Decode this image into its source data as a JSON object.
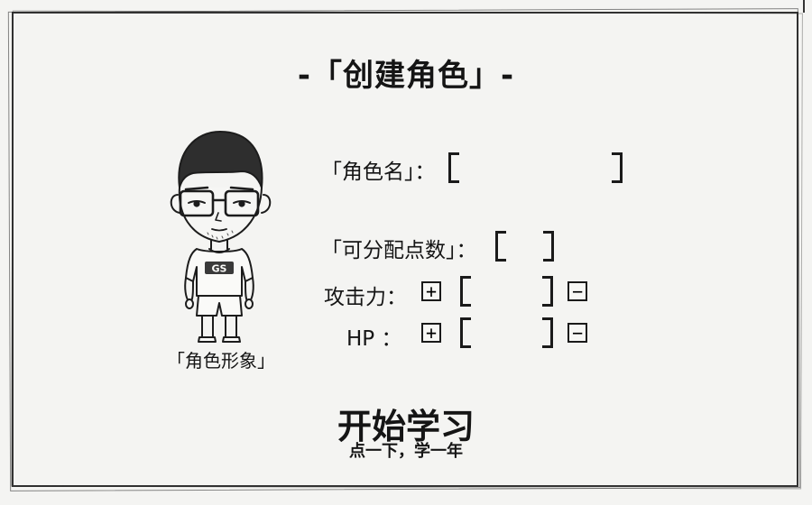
{
  "title": "-「创建角色」-",
  "avatar": {
    "caption": "「角色形象」",
    "shirt_text": "GS"
  },
  "name_field": {
    "label": "「角色名」：",
    "value": ""
  },
  "points": {
    "label": "「可分配点数」：",
    "value": ""
  },
  "stats": [
    {
      "label": "攻击力：",
      "value": "",
      "plus": "+",
      "minus": "−"
    },
    {
      "label": "HP  ：",
      "value": "",
      "plus": "+",
      "minus": "−"
    }
  ],
  "start": {
    "label": "开始学习",
    "subtitle": "点一下，学一年"
  }
}
